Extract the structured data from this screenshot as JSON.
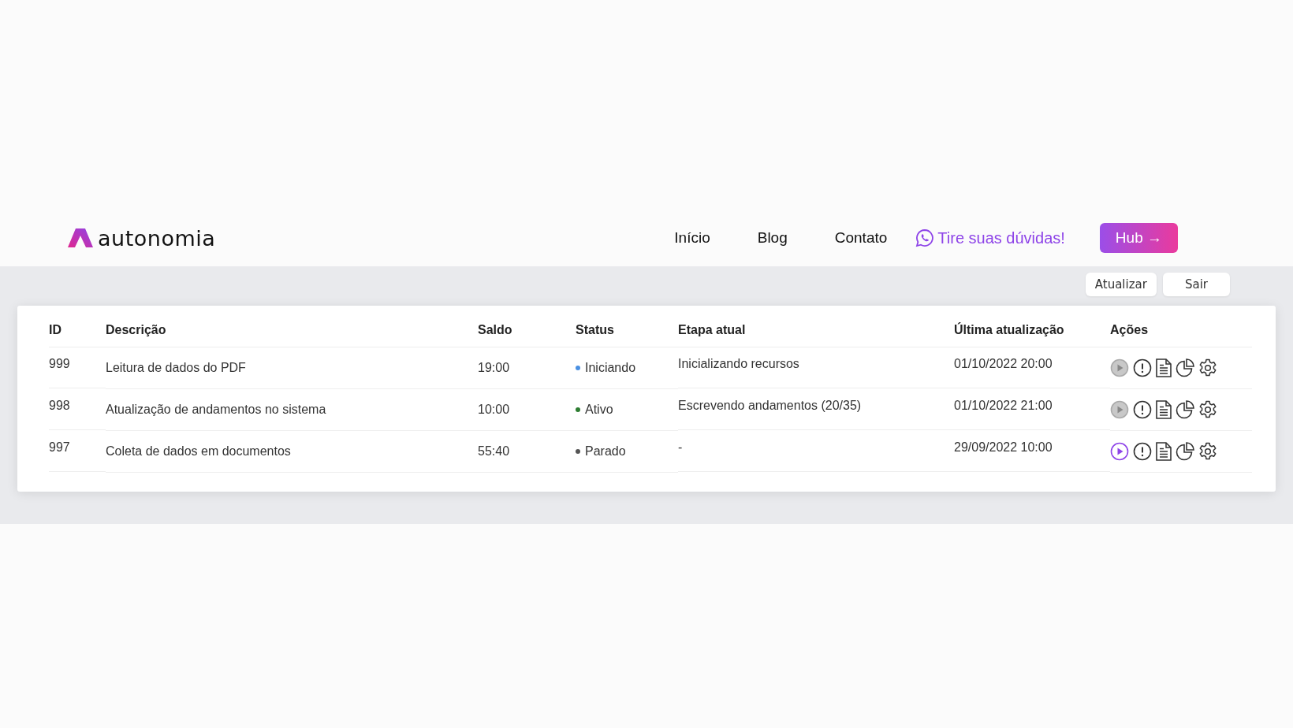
{
  "header": {
    "logo": "autonomia",
    "nav": [
      "Início",
      "Blog",
      "Contato"
    ],
    "whatsapp_link": "Tire suas dúvidas!",
    "hub_button": "Hub →"
  },
  "toolbar": {
    "buttons": [
      "Atualizar",
      "Sair"
    ]
  },
  "table": {
    "columns": [
      "ID",
      "Descrição",
      "Saldo",
      "Status",
      "Etapa atual",
      "Última atualização",
      "Ações"
    ],
    "rows": [
      {
        "id": "999",
        "description": "Leitura de dados do PDF",
        "balance": "19:00",
        "status": "Iniciando",
        "color": "#4a90e2",
        "stage": "Inicializando recursos",
        "updated": "01/10/2022 20:00",
        "play_disabled": true
      },
      {
        "id": "998",
        "description": "Atualização de andamentos no sistema",
        "balance": "10:00",
        "status": "Ativo",
        "color": "#2e7d32",
        "stage": "Escrevendo andamentos (20/35)",
        "updated": "01/10/2022 21:00",
        "play_disabled": true
      },
      {
        "id": "997",
        "description": "Coleta de dados em documentos",
        "balance": "55:40",
        "status": "Parado",
        "color": "#555555",
        "stage": "-",
        "updated": "29/09/2022 10:00",
        "play_disabled": false
      }
    ]
  }
}
